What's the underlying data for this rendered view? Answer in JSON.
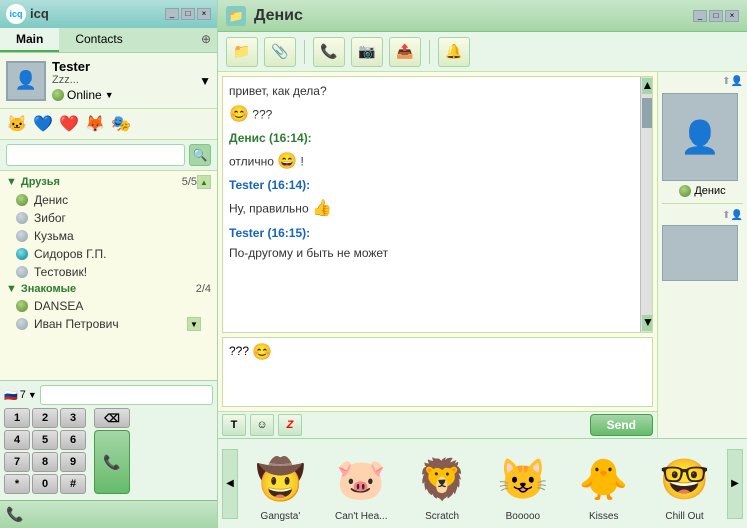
{
  "app": {
    "title": "icq",
    "chat_contact": "Денис"
  },
  "left_panel": {
    "tabs": [
      {
        "label": "Main",
        "active": true
      },
      {
        "label": "Contacts",
        "active": false
      }
    ],
    "user": {
      "name": "Tester",
      "status_text": "Zzz...",
      "status": "Online"
    },
    "search_placeholder": "",
    "groups": [
      {
        "name": "Друзья",
        "count": "5/5",
        "contacts": [
          {
            "name": "Денис",
            "status": "online"
          },
          {
            "name": "Зибог",
            "status": "offline"
          },
          {
            "name": "Кузьма",
            "status": "offline"
          },
          {
            "name": "Сидоров Г.П.",
            "status": "special"
          },
          {
            "name": "Тестовик!",
            "status": "offline"
          }
        ]
      },
      {
        "name": "Знакомые",
        "count": "2/4",
        "contacts": [
          {
            "name": "DANSEA",
            "status": "online"
          },
          {
            "name": "Иван Петрович",
            "status": "offline"
          }
        ]
      }
    ],
    "dialer": {
      "flag": "7",
      "buttons": [
        "1",
        "2",
        "3",
        "4",
        "5",
        "6",
        "7",
        "8",
        "9",
        "*",
        "0",
        "#"
      ]
    }
  },
  "chat": {
    "title": "Денис",
    "toolbar_buttons": [
      "📁",
      "📎",
      "📞",
      "📷",
      "📤",
      "🔔"
    ],
    "messages": [
      {
        "type": "plain",
        "text": "привет, как дела?"
      },
      {
        "type": "plain",
        "text": "???",
        "emoji": "😊"
      },
      {
        "type": "sender",
        "sender": "Денис (16:14):",
        "text": "отлично",
        "emoji": "😄",
        "suffix": "!"
      },
      {
        "type": "sender",
        "sender": "Tester (16:14):",
        "text": "Ну, правильно",
        "emoji": "👍"
      },
      {
        "type": "sender",
        "sender": "Tester (16:15):",
        "text": "По-другому и быть не может"
      }
    ],
    "input_text": "???",
    "input_emoji": "😊",
    "send_button": "Send",
    "format_buttons": [
      "T",
      "☺",
      "Z"
    ]
  },
  "emoji_strip": {
    "items": [
      {
        "label": "Gangsta'",
        "emoji": "🤠"
      },
      {
        "label": "Can't Hea...",
        "emoji": "🐷"
      },
      {
        "label": "Scratch",
        "emoji": "🦁"
      },
      {
        "label": "Booooo",
        "emoji": "😺"
      },
      {
        "label": "Kisses",
        "emoji": "🐥"
      },
      {
        "label": "Chill Out",
        "emoji": "🤓"
      }
    ]
  },
  "contact_sidebar": {
    "name": "Денис",
    "status_dot": true
  }
}
